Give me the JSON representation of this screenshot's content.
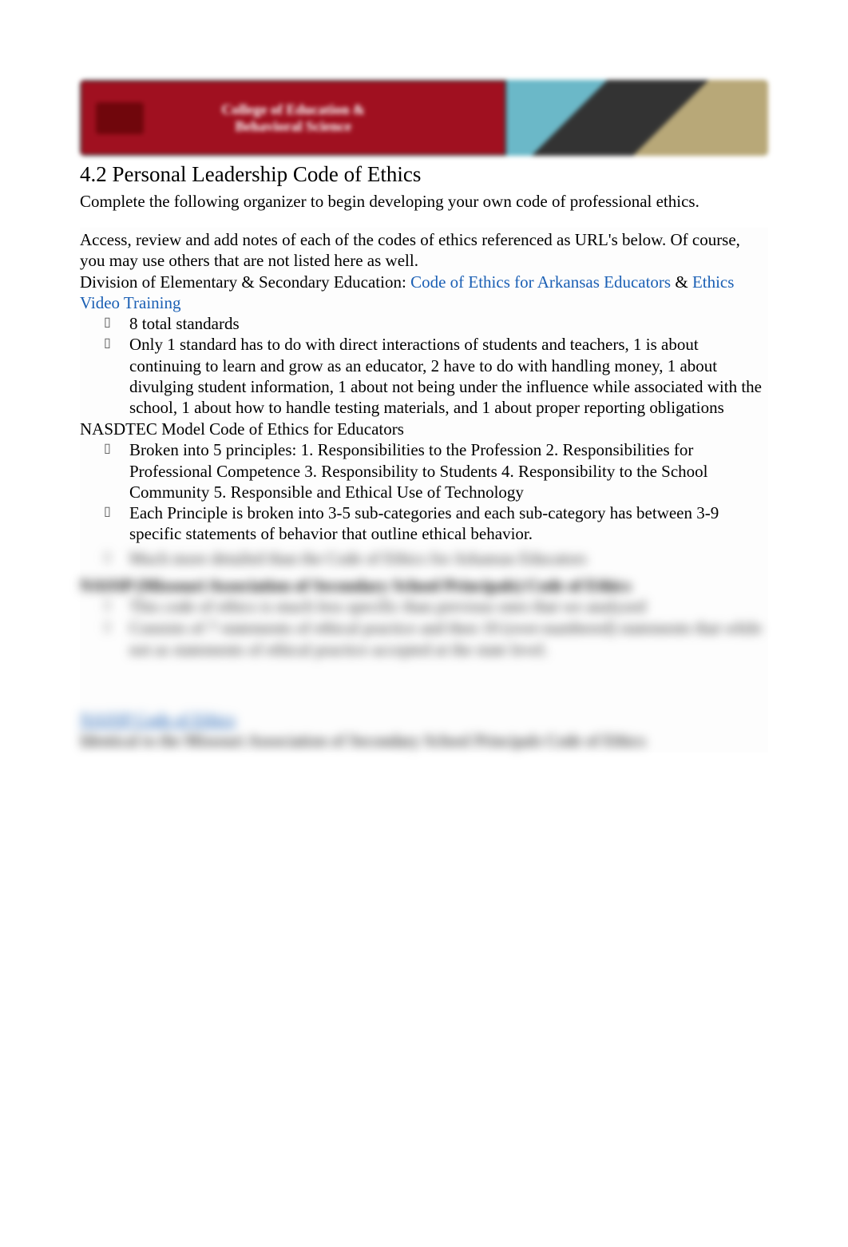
{
  "banner": {
    "line1": "College of Education &",
    "line2": "Behavioral Science"
  },
  "heading": "4.2 Personal Leadership Code of Ethics",
  "intro": "Complete the following organizer to begin developing your own code of professional ethics.",
  "access_note": "Access, review and add notes of each of the codes of ethics referenced as URL's below. Of course, you may use others that are not listed here as well.",
  "division_prefix": "Division of Elementary & Secondary Education:",
  "link1": "Code of Ethics for Arkansas Educators",
  "amp": " & ",
  "link2": "Ethics Video Training",
  "section1_bullets": [
    "8 total standards",
    "Only 1 standard has to do with direct interactions of students and teachers, 1 is about continuing to learn and grow as an educator, 2 have to do with handling money, 1 about divulging student information, 1 about not being under the influence while associated with the school, 1 about how to handle testing materials, and 1 about proper reporting obligations"
  ],
  "section2_title": "NASDTEC Model Code of Ethics for Educators",
  "section2_bullets": [
    "Broken into 5 principles: 1. Responsibilities to the Profession 2. Responsibilities for Professional Competence 3. Responsibility to Students 4. Responsibility to the School Community 5. Responsible and Ethical Use of Technology",
    "Each Principle is broken into 3-5 sub-categories and each sub-category has between 3-9 specific statements of behavior that outline ethical behavior."
  ],
  "blurred": {
    "line1": "Much more detailed than the Code of Ethics for Arkansas Educators",
    "heading": "NASSP (Missouri Association of Secondary School Principals) Code of Ethics",
    "line2": "This code of ethics is much less specific than previous ones that we analyzed",
    "line3": "Consists of 7 statements of ethical practice and then 10 (over-numbered) statements that while not as statements of ethical practice accepted at the state level.",
    "link_label": "NASSP Code of Ethics",
    "bottom": "Identical to the Missouri Association of Secondary School Principals Code of Ethics"
  }
}
